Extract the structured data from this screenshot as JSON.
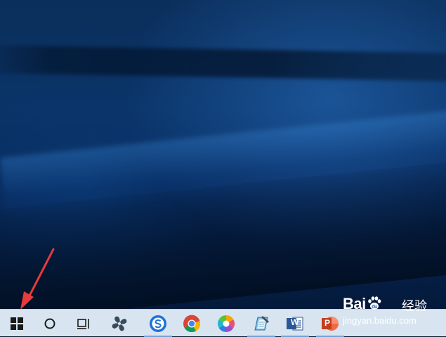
{
  "desktop": {
    "accent": "#0a3468"
  },
  "taskbar": {
    "background": "#d8e5f0",
    "items": [
      {
        "id": "start",
        "icon": "windows-logo-icon",
        "running": false
      },
      {
        "id": "search",
        "icon": "cortana-circle-icon",
        "running": false
      },
      {
        "id": "task-view",
        "icon": "task-view-icon",
        "running": false
      },
      {
        "id": "app-pinwheel",
        "icon": "pinwheel-app-icon",
        "running": false
      },
      {
        "id": "sogou-browser",
        "icon": "sogou-s-icon",
        "running": true
      },
      {
        "id": "chrome",
        "icon": "chrome-icon",
        "running": false
      },
      {
        "id": "colorful-app",
        "icon": "colorful-flower-icon",
        "running": false
      },
      {
        "id": "notepad-app",
        "icon": "notepad-icon",
        "running": true
      },
      {
        "id": "word",
        "icon": "word-icon",
        "running": true
      },
      {
        "id": "powerpoint",
        "icon": "powerpoint-icon",
        "running": true
      }
    ],
    "word_letter": "W",
    "ppt_letter": "P"
  },
  "annotation": {
    "arrow_color": "#e83b3b"
  },
  "watermark": {
    "brand": "Bai",
    "brand_suffix": "du",
    "cn_text": "经验",
    "url": "jingyan.baidu.com"
  }
}
